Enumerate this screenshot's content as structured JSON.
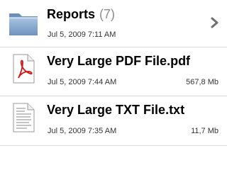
{
  "rows": [
    {
      "title": "Reports",
      "count": "(7)",
      "date": "Jul 5, 2009 7:11 AM",
      "icon": "folder-icon"
    },
    {
      "title": "Very Large PDF File.pdf",
      "date": "Jul 5, 2009 7:44 AM",
      "size": "567,8 Mb",
      "icon": "pdf-file-icon"
    },
    {
      "title": "Very Large TXT File.txt",
      "date": "Jul 5, 2009 7:35 AM",
      "size": "11,7 Mb",
      "icon": "text-file-icon"
    }
  ],
  "colors": {
    "separator": "#d9d9d9",
    "count_text": "#8c8c8c",
    "folder_blue": "#7fa2c8",
    "pdf_red": "#d01515"
  }
}
